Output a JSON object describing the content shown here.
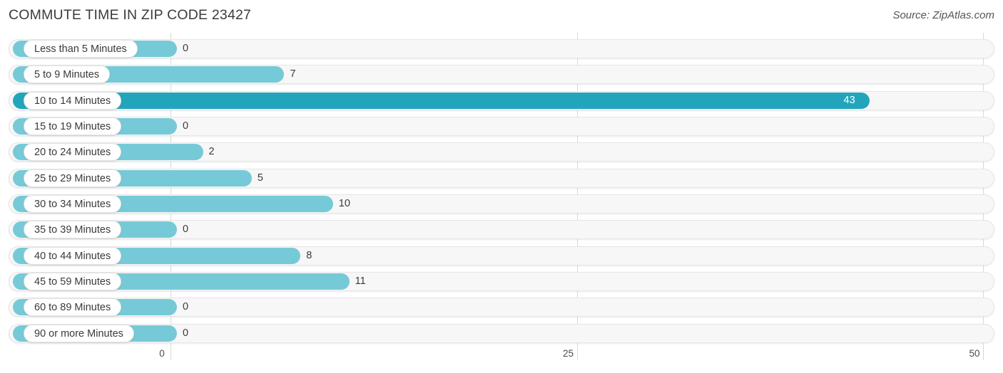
{
  "header": {
    "title": "COMMUTE TIME IN ZIP CODE 23427",
    "source": "Source: ZipAtlas.com"
  },
  "colors": {
    "bar": "#76cad7",
    "bar_highlight": "#22a5bb",
    "track": "#f7f7f7",
    "gridline": "#d9d9d9",
    "text": "#3a3a3a",
    "value_in_bar_text": "#ffffff"
  },
  "chart_data": {
    "type": "bar",
    "orientation": "horizontal",
    "title": "COMMUTE TIME IN ZIP CODE 23427",
    "xlabel": "",
    "ylabel": "",
    "xlim": [
      0,
      50
    ],
    "xticks": [
      0,
      25,
      50
    ],
    "xtick_labels": [
      "0",
      "25",
      "50"
    ],
    "grid": true,
    "legend": false,
    "categories": [
      "Less than 5 Minutes",
      "5 to 9 Minutes",
      "10 to 14 Minutes",
      "15 to 19 Minutes",
      "20 to 24 Minutes",
      "25 to 29 Minutes",
      "30 to 34 Minutes",
      "35 to 39 Minutes",
      "40 to 44 Minutes",
      "45 to 59 Minutes",
      "60 to 89 Minutes",
      "90 or more Minutes"
    ],
    "values": [
      0,
      7,
      43,
      0,
      2,
      5,
      10,
      0,
      8,
      11,
      0,
      0
    ],
    "value_labels": [
      "0",
      "7",
      "43",
      "0",
      "2",
      "5",
      "10",
      "0",
      "8",
      "11",
      "0",
      "0"
    ],
    "highlight_index": 2
  }
}
